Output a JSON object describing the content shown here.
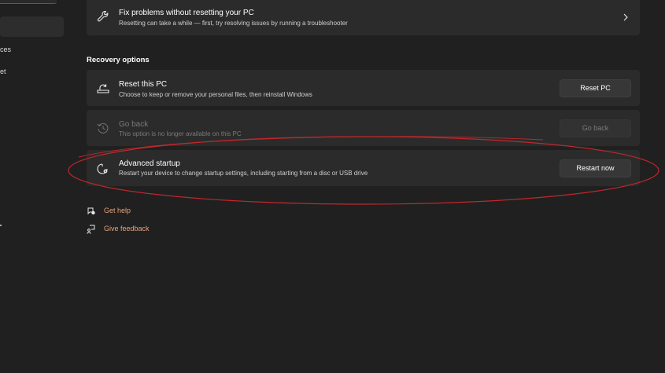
{
  "sidebar": {
    "items": [
      {
        "label": "ces"
      },
      {
        "label": "et"
      }
    ]
  },
  "troubleshoot": {
    "title": "Fix problems without resetting your PC",
    "description": "Resetting can take a while — first, try resolving issues by running a troubleshooter"
  },
  "recovery": {
    "section_title": "Recovery options",
    "reset": {
      "title": "Reset this PC",
      "description": "Choose to keep or remove your personal files, then reinstall Windows",
      "button": "Reset PC"
    },
    "goback": {
      "title": "Go back",
      "description": "This option is no longer available on this PC",
      "button": "Go back",
      "enabled": false
    },
    "advanced": {
      "title": "Advanced startup",
      "description": "Restart your device to change startup settings, including starting from a disc or USB drive",
      "button": "Restart now"
    }
  },
  "links": {
    "help": "Get help",
    "feedback": "Give feedback"
  },
  "colors": {
    "background": "#202020",
    "card": "#2b2b2b",
    "link": "#e8a27c",
    "annotation": "#c0282d"
  },
  "icons": {
    "troubleshoot": "wrench-icon",
    "reset": "reset-pc-icon",
    "goback": "history-icon",
    "advanced": "advanced-startup-icon",
    "help": "help-chat-icon",
    "feedback": "feedback-icon",
    "chevron": "chevron-right-icon"
  }
}
